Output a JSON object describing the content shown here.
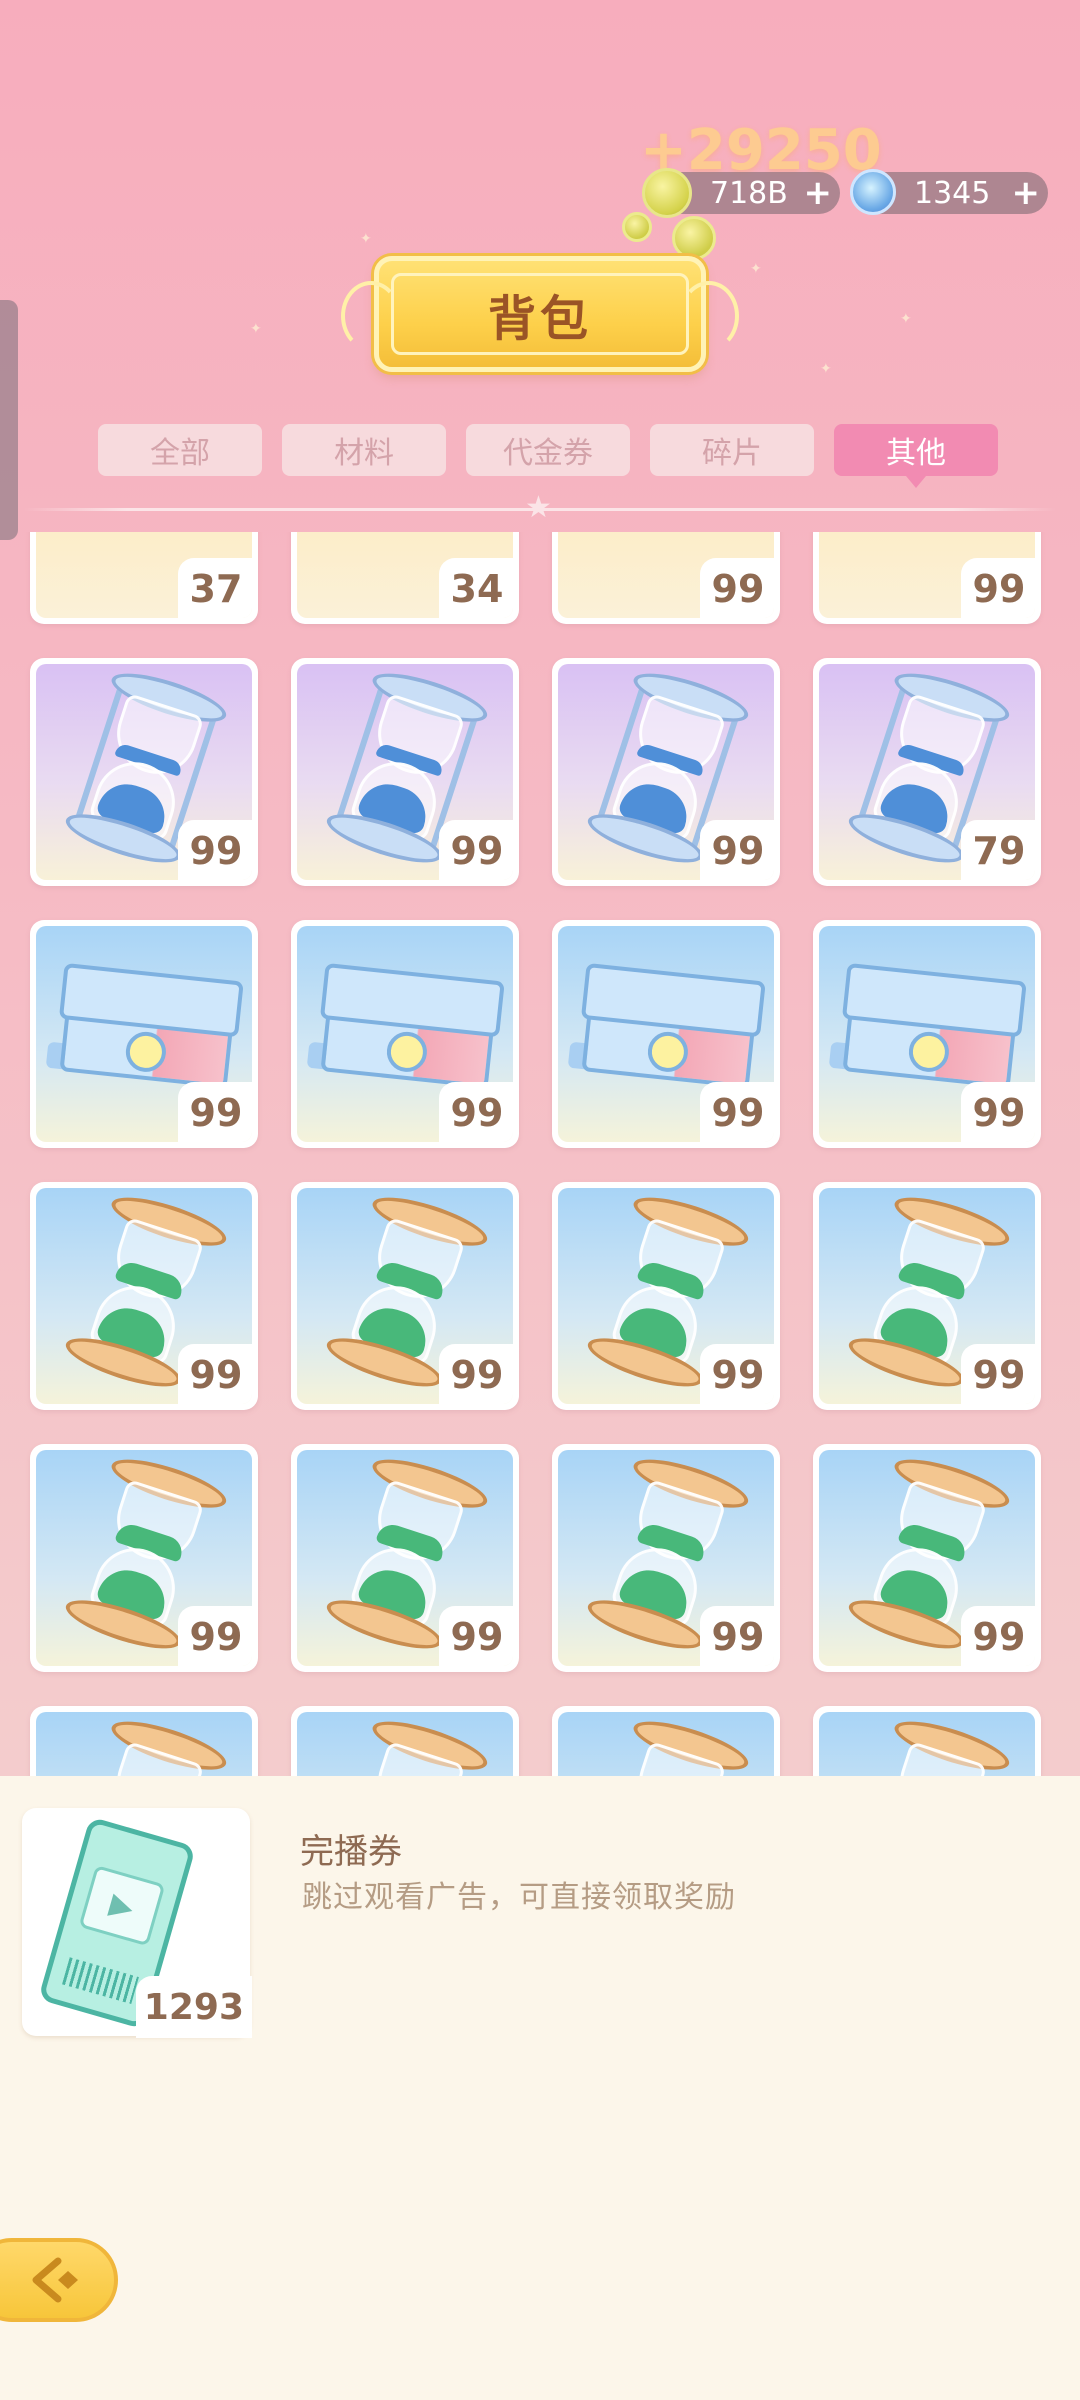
{
  "currency": {
    "gain_text": "+29250",
    "coins": {
      "value": "718B",
      "icon": "coin-icon",
      "plus": "+"
    },
    "gems": {
      "value": "1345",
      "icon": "gem-icon",
      "plus": "+"
    }
  },
  "header": {
    "title": "背包"
  },
  "tabs": [
    {
      "label": "全部",
      "active": false
    },
    {
      "label": "材料",
      "active": false
    },
    {
      "label": "代金券",
      "active": false
    },
    {
      "label": "碎片",
      "active": false
    },
    {
      "label": "其他",
      "active": true
    }
  ],
  "grid": {
    "rows": [
      {
        "items": [
          {
            "art": "partial-misc",
            "count": "37"
          },
          {
            "art": "partial-purple",
            "count": "34"
          },
          {
            "art": "partial-blue",
            "count": "99"
          },
          {
            "art": "partial-blue",
            "count": "99"
          }
        ]
      },
      {
        "items": [
          {
            "art": "blue-hourglass",
            "count": "99"
          },
          {
            "art": "blue-hourglass",
            "count": "99"
          },
          {
            "art": "blue-hourglass",
            "count": "99"
          },
          {
            "art": "blue-hourglass",
            "count": "79"
          }
        ]
      },
      {
        "items": [
          {
            "art": "gift-box",
            "count": "99"
          },
          {
            "art": "gift-box",
            "count": "99"
          },
          {
            "art": "gift-box",
            "count": "99"
          },
          {
            "art": "gift-box",
            "count": "99"
          }
        ]
      },
      {
        "items": [
          {
            "art": "green-hourglass",
            "count": "99"
          },
          {
            "art": "green-hourglass",
            "count": "99"
          },
          {
            "art": "green-hourglass",
            "count": "99"
          },
          {
            "art": "green-hourglass",
            "count": "99"
          }
        ]
      },
      {
        "items": [
          {
            "art": "green-hourglass",
            "count": "99"
          },
          {
            "art": "green-hourglass",
            "count": "99"
          },
          {
            "art": "green-hourglass",
            "count": "99"
          },
          {
            "art": "green-hourglass",
            "count": "99"
          }
        ]
      },
      {
        "items": [
          {
            "art": "green-hourglass",
            "count": ""
          },
          {
            "art": "green-hourglass",
            "count": ""
          },
          {
            "art": "green-hourglass",
            "count": ""
          },
          {
            "art": "green-hourglass",
            "count": ""
          }
        ]
      }
    ]
  },
  "detail": {
    "name": "完播券",
    "description": "跳过观看广告，可直接领取奖励",
    "count": "1293",
    "icon": "video-ticket-icon"
  },
  "back_button": {
    "icon": "back-arrow-icon"
  }
}
